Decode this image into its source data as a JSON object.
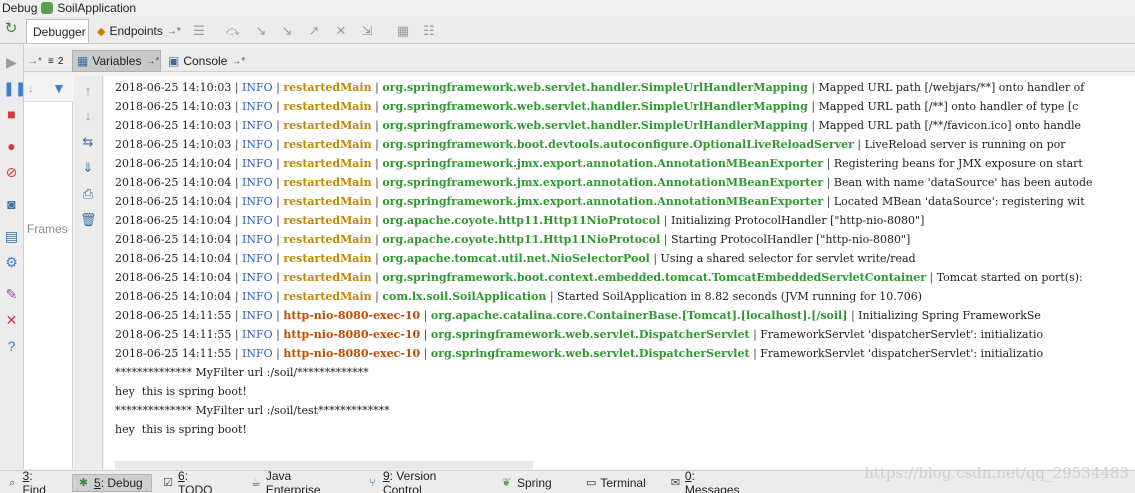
{
  "title_bar": {
    "debug_label": "Debug",
    "config_name": "SoilApplication"
  },
  "tabs": {
    "debugger": "Debugger",
    "endpoints": "Endpoints",
    "endpoints_pin": "→*"
  },
  "subtabs": {
    "threads_pin": "→*",
    "frames_count": "2",
    "variables": "Variables",
    "variables_pin": "→*",
    "console": "Console",
    "console_pin": "→*"
  },
  "frames_panel": {
    "label": "Frames"
  },
  "console_lines": [
    {
      "ts": "2018-06-25 14:10:03",
      "level": "INFO",
      "thread": "restartedMain",
      "cls": "org.springframework.web.servlet.handler.SimpleUrlHandlerMapping",
      "msg": "Mapped URL path [/webjars/**] onto handler of"
    },
    {
      "ts": "2018-06-25 14:10:03",
      "level": "INFO",
      "thread": "restartedMain",
      "cls": "org.springframework.web.servlet.handler.SimpleUrlHandlerMapping",
      "msg": "Mapped URL path [/**] onto handler of type [c"
    },
    {
      "ts": "2018-06-25 14:10:03",
      "level": "INFO",
      "thread": "restartedMain",
      "cls": "org.springframework.web.servlet.handler.SimpleUrlHandlerMapping",
      "msg": "Mapped URL path [/**/favicon.ico] onto handle"
    },
    {
      "ts": "2018-06-25 14:10:03",
      "level": "INFO",
      "thread": "restartedMain",
      "cls": "org.springframework.boot.devtools.autoconfigure.OptionalLiveReloadServer",
      "msg": "LiveReload server is running on por"
    },
    {
      "ts": "2018-06-25 14:10:04",
      "level": "INFO",
      "thread": "restartedMain",
      "cls": "org.springframework.jmx.export.annotation.AnnotationMBeanExporter",
      "msg": "Registering beans for JMX exposure on start"
    },
    {
      "ts": "2018-06-25 14:10:04",
      "level": "INFO",
      "thread": "restartedMain",
      "cls": "org.springframework.jmx.export.annotation.AnnotationMBeanExporter",
      "msg": "Bean with name 'dataSource' has been autode"
    },
    {
      "ts": "2018-06-25 14:10:04",
      "level": "INFO",
      "thread": "restartedMain",
      "cls": "org.springframework.jmx.export.annotation.AnnotationMBeanExporter",
      "msg": "Located MBean 'dataSource': registering wit"
    },
    {
      "ts": "2018-06-25 14:10:04",
      "level": "INFO",
      "thread": "restartedMain",
      "cls": "org.apache.coyote.http11.Http11NioProtocol",
      "msg": "Initializing ProtocolHandler [\"http-nio-8080\"]"
    },
    {
      "ts": "2018-06-25 14:10:04",
      "level": "INFO",
      "thread": "restartedMain",
      "cls": "org.apache.coyote.http11.Http11NioProtocol",
      "msg": "Starting ProtocolHandler [\"http-nio-8080\"]"
    },
    {
      "ts": "2018-06-25 14:10:04",
      "level": "INFO",
      "thread": "restartedMain",
      "cls": "org.apache.tomcat.util.net.NioSelectorPool",
      "msg": "Using a shared selector for servlet write/read"
    },
    {
      "ts": "2018-06-25 14:10:04",
      "level": "INFO",
      "thread": "restartedMain",
      "cls": "org.springframework.boot.context.embedded.tomcat.TomcatEmbeddedServletContainer",
      "msg": "Tomcat started on port(s):"
    },
    {
      "ts": "2018-06-25 14:10:04",
      "level": "INFO",
      "thread": "restartedMain",
      "cls": "com.lx.soil.SoilApplication",
      "msg": "Started SoilApplication in 8.82 seconds (JVM running for 10.706)"
    },
    {
      "ts": "2018-06-25 14:11:55",
      "level": "INFO",
      "thread": "http-nio-8080-exec-10",
      "cls": "org.apache.catalina.core.ContainerBase.[Tomcat].[localhost].[/soil]",
      "msg": "Initializing Spring FrameworkSe"
    },
    {
      "ts": "2018-06-25 14:11:55",
      "level": "INFO",
      "thread": "http-nio-8080-exec-10",
      "cls": "org.springframework.web.servlet.DispatcherServlet",
      "msg": "FrameworkServlet 'dispatcherServlet': initializatio"
    },
    {
      "ts": "2018-06-25 14:11:55",
      "level": "INFO",
      "thread": "http-nio-8080-exec-10",
      "cls": "org.springframework.web.servlet.DispatcherServlet",
      "msg": "FrameworkServlet 'dispatcherServlet': initializatio"
    }
  ],
  "console_plain": [
    "************** MyFilter url :/soil/*************",
    "hey  this is spring boot!",
    "************** MyFilter url :/soil/test*************",
    "hey  this is spring boot!"
  ],
  "bottom_tabs": [
    {
      "key": "3",
      "label": ": Find",
      "icon": "search-icon"
    },
    {
      "key": "5",
      "label": ": Debug",
      "icon": "bug-icon"
    },
    {
      "key": "6",
      "label": ": TODO",
      "icon": "todo-icon"
    },
    {
      "key": "",
      "label": "Java Enterprise",
      "icon": "java-enterprise-icon"
    },
    {
      "key": "9",
      "label": ": Version Control",
      "icon": "vcs-icon"
    },
    {
      "key": "",
      "label": "Spring",
      "icon": "spring-icon"
    },
    {
      "key": "",
      "label": "Terminal",
      "icon": "terminal-icon"
    },
    {
      "key": "0",
      "label": ": Messages",
      "icon": "messages-icon"
    }
  ],
  "watermark": "https://blog.csdn.net/qq_29534483",
  "colors": {
    "level": "#2f5fbf",
    "thread": "#c08a00",
    "http_thread": "#c24b00",
    "class": "#2e9a2e"
  }
}
